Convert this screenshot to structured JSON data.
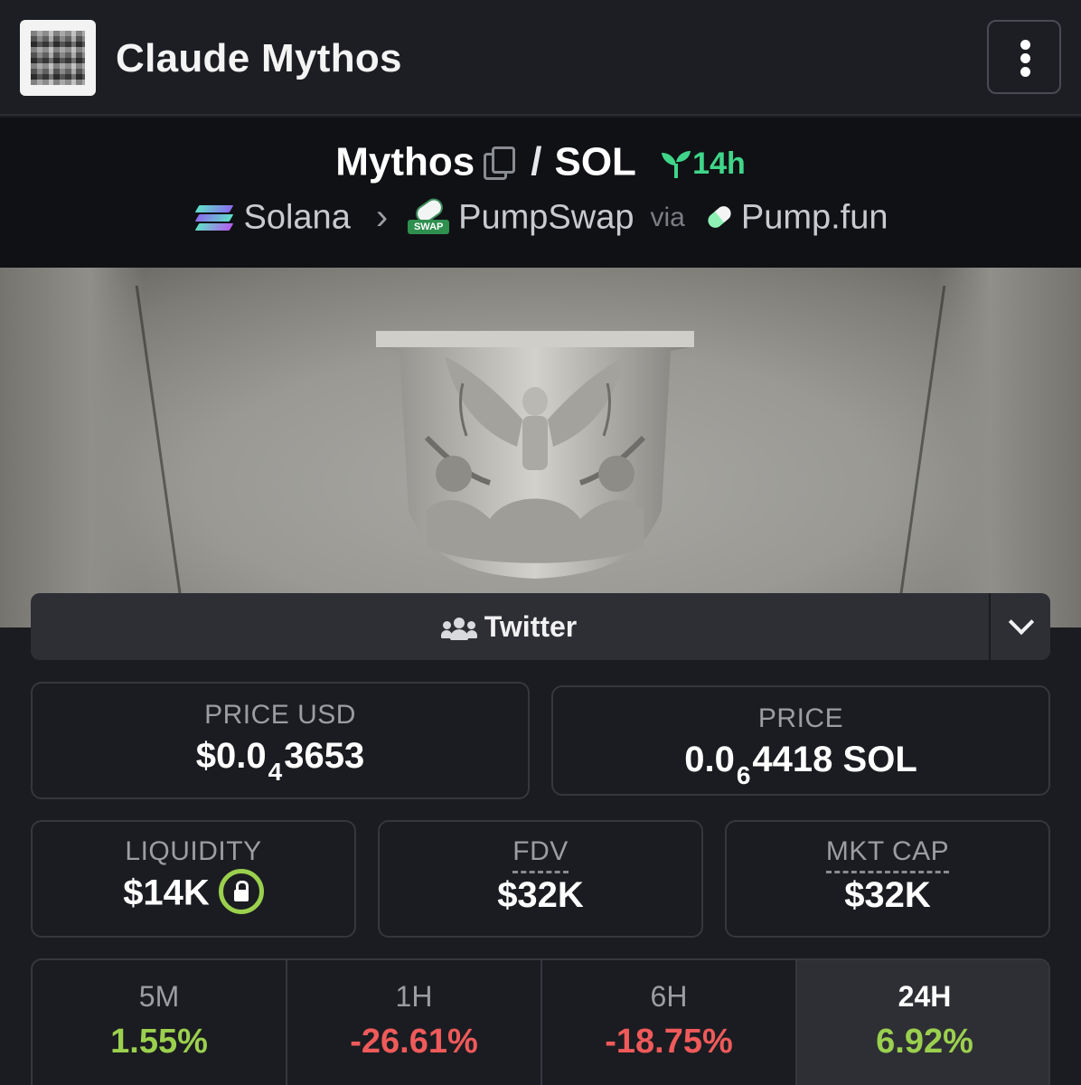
{
  "app": {
    "title": "Claude Mythos"
  },
  "pair": {
    "base": "Mythos",
    "separator": "/",
    "quote": "SOL",
    "age": "14h",
    "chain": "Solana",
    "dex": "PumpSwap",
    "via": "via",
    "launchpad": "Pump.fun"
  },
  "social": {
    "label": "Twitter"
  },
  "stats": {
    "price_usd": {
      "label": "PRICE USD",
      "prefix": "$0.0",
      "zeros": "4",
      "digits": "3653"
    },
    "price_native": {
      "label": "PRICE",
      "prefix": "0.0",
      "zeros": "6",
      "digits": "4418 SOL"
    },
    "liquidity": {
      "label": "LIQUIDITY",
      "value": "$14K"
    },
    "fdv": {
      "label": "FDV",
      "value": "$32K"
    },
    "mkt_cap": {
      "label": "MKT CAP",
      "value": "$32K"
    }
  },
  "timeframes": [
    {
      "label": "5M",
      "value": "1.55%",
      "color": "#9bd04e"
    },
    {
      "label": "1H",
      "value": "-26.61%",
      "color": "#f05a5a"
    },
    {
      "label": "6H",
      "value": "-18.75%",
      "color": "#f05a5a"
    },
    {
      "label": "24H",
      "value": "6.92%",
      "color": "#9bd04e"
    }
  ],
  "colors": {
    "accent_green": "#3fd68a",
    "positive": "#9bd04e",
    "negative": "#f05a5a"
  },
  "icons": [
    "copy-icon",
    "sprout-icon",
    "solana-icon",
    "pumpswap-icon",
    "pumpfun-icon",
    "people-icon",
    "chevron-down-icon",
    "lock-icon",
    "kebab-menu-icon"
  ]
}
